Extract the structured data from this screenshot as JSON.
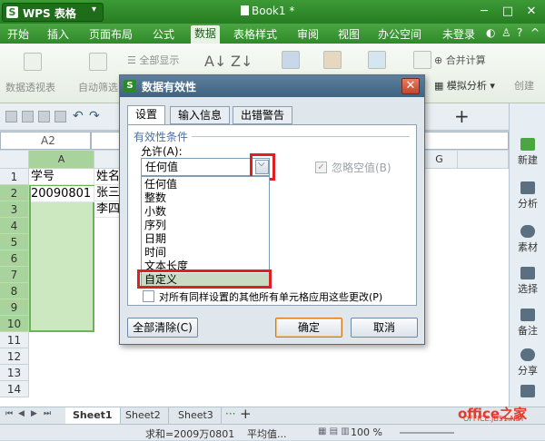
{
  "app": {
    "logo": "S",
    "title": "WPS 表格",
    "document_title": "Book1 *",
    "colors": {
      "brand_green": "#2f8a29",
      "dialog_blue": "#3f6382",
      "highlight_red": "#e02020",
      "selection_green": "#cce8c0"
    }
  },
  "menu": {
    "items": [
      "开始",
      "插入",
      "页面布局",
      "公式",
      "数据",
      "表格样式",
      "审阅",
      "视图",
      "办公空间"
    ],
    "active": "数据",
    "login": "未登录"
  },
  "ribbon": {
    "pivot": "数据透视表",
    "auto_filter": "自动筛选",
    "show_all": "全部显示",
    "merge_calc": "合并计算",
    "simulate": "模拟分析",
    "create": "创建"
  },
  "namebox": {
    "value": "A2"
  },
  "sheet": {
    "columns": [
      "A",
      "G"
    ],
    "rows": [
      "1",
      "2",
      "3",
      "4",
      "5",
      "6",
      "7",
      "8",
      "9",
      "10",
      "11",
      "12",
      "13",
      "14"
    ],
    "cells": {
      "A1": "学号",
      "B1": "姓名",
      "A2": "20090801",
      "B2": "张三",
      "B3": "李四"
    }
  },
  "right_panel": {
    "items": [
      "新建",
      "分析",
      "素材",
      "选择",
      "备注",
      "分享"
    ]
  },
  "tabs": {
    "sheets": [
      "Sheet1",
      "Sheet2",
      "Sheet3"
    ],
    "more": "···",
    "add": "+"
  },
  "status": {
    "sum": "求和=2009万0801",
    "avg": "平均值...",
    "zoom": "100 %"
  },
  "dialog": {
    "logo": "S",
    "title": "数据有效性",
    "close": "✕",
    "tabs": [
      "设置",
      "输入信息",
      "出错警告"
    ],
    "active_tab": "设置",
    "section": "有效性条件",
    "allow_label": "允许(A):",
    "allow_value": "任何值",
    "ignore_blank": "忽略空值(B)",
    "dropdown_items": [
      "任何值",
      "整数",
      "小数",
      "序列",
      "日期",
      "时间",
      "文本长度",
      "自定义"
    ],
    "highlighted_item": "自定义",
    "apply_all": "对所有同样设置的其他所有单元格应用这些更改(P)",
    "clear_all": "全部清除(C)",
    "ok": "确定",
    "cancel": "取消"
  },
  "watermark": {
    "text": "office之家",
    "sub": "OFFICE.JB51.NET"
  }
}
